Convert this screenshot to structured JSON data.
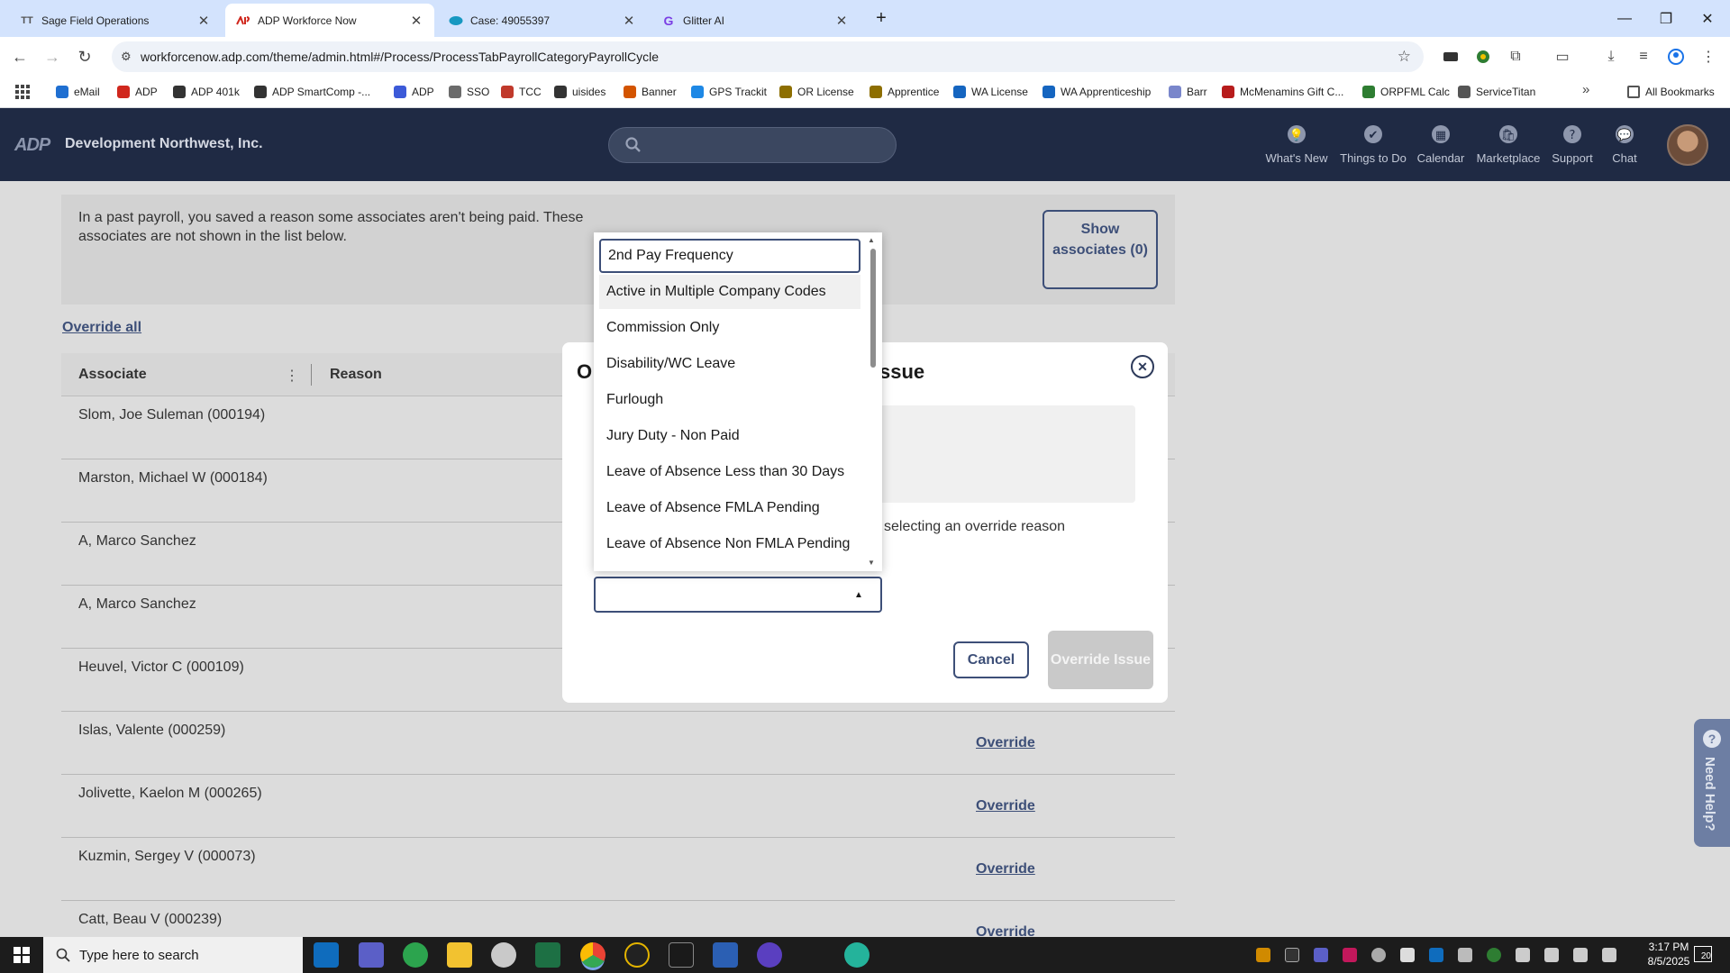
{
  "browser": {
    "tabs": [
      {
        "label": "Sage Field Operations",
        "favicon": "TT",
        "active": false
      },
      {
        "label": "ADP Workforce Now",
        "favicon": "adp-icon",
        "active": true
      },
      {
        "label": "Case: 49055397",
        "favicon": "salesforce-cloud-icon",
        "active": false
      },
      {
        "label": "Glitter AI",
        "favicon": "G",
        "active": false
      }
    ],
    "url": "workforcenow.adp.com/theme/admin.html#/Process/ProcessTabPayrollCategoryPayrollCycle",
    "bookmarks": [
      {
        "label": "eMail",
        "color": "#1f6fd1"
      },
      {
        "label": "ADP",
        "color": "#d0271d"
      },
      {
        "label": "ADP 401k",
        "color": "#333333"
      },
      {
        "label": "ADP SmartComp -...",
        "color": "#333333"
      },
      {
        "label": "ADP",
        "color": "#3c5ad8"
      },
      {
        "label": "SSO",
        "color": "#6b6b6b"
      },
      {
        "label": "TCC",
        "color": "#c0392b"
      },
      {
        "label": "uisides",
        "color": "#333333"
      },
      {
        "label": "Banner",
        "color": "#d35400"
      },
      {
        "label": "GPS Trackit",
        "color": "#1e88e5"
      },
      {
        "label": "OR License",
        "color": "#8d6e00"
      },
      {
        "label": "Apprentice",
        "color": "#8d6e00"
      },
      {
        "label": "WA License",
        "color": "#1565c0"
      },
      {
        "label": "WA Apprenticeship",
        "color": "#1565c0"
      },
      {
        "label": "Barr",
        "color": "#7986cb"
      },
      {
        "label": "McMenamins Gift C...",
        "color": "#b71c1c"
      },
      {
        "label": "ORPFML Calc",
        "color": "#2e7d32"
      },
      {
        "label": "ServiceTitan",
        "color": "#555555"
      }
    ],
    "all_bookmarks": "All Bookmarks"
  },
  "adp": {
    "logo": "ADP",
    "company": "Development Northwest, Inc.",
    "nav": [
      {
        "label": "What's New",
        "icon": "lightbulb-icon"
      },
      {
        "label": "Things to Do",
        "icon": "checkmark-icon"
      },
      {
        "label": "Calendar",
        "icon": "calendar-icon"
      },
      {
        "label": "Marketplace",
        "icon": "bag-icon"
      },
      {
        "label": "Support",
        "icon": "question-icon"
      },
      {
        "label": "Chat",
        "icon": "chat-icon"
      }
    ]
  },
  "page": {
    "past_message": "In a past payroll, you saved a reason some associates aren't being paid. These associates are not shown in the list below.",
    "show_associates": "Show associates (0)",
    "override_all": "Override all",
    "columns": {
      "associate": "Associate",
      "reason": "Reason"
    },
    "rows": [
      {
        "name": "Slom, Joe Suleman (000194)",
        "action": ""
      },
      {
        "name": "Marston, Michael W (000184)",
        "action": ""
      },
      {
        "name": "A, Marco Sanchez",
        "action": ""
      },
      {
        "name": "A, Marco Sanchez",
        "action": ""
      },
      {
        "name": "Heuvel, Victor C (000109)",
        "action": ""
      },
      {
        "name": "Islas, Valente (000259)",
        "action": "Override"
      },
      {
        "name": "Jolivette, Kaelon M (000265)",
        "action": "Override"
      },
      {
        "name": "Kuzmin, Sergey V (000073)",
        "action": "Override"
      },
      {
        "name": "Catt, Beau V (000239)",
        "action": "Override"
      }
    ],
    "need_help": "Need Help?"
  },
  "modal": {
    "title_start": "O",
    "title_end": "ssue",
    "instruction": "selecting an override reason",
    "cancel": "Cancel",
    "override": "Override Issue"
  },
  "dropdown": {
    "options": [
      "2nd Pay Frequency",
      "Active in Multiple Company Codes",
      "Commission Only",
      "Disability/WC Leave",
      "Furlough",
      "Jury Duty - Non Paid",
      "Leave of Absence Less than 30 Days",
      "Leave of Absence FMLA Pending",
      "Leave of Absence Non FMLA Pending"
    ],
    "focused_index": 0,
    "hover_index": 1
  },
  "taskbar": {
    "search_placeholder": "Type here to search",
    "time": "3:17 PM",
    "date": "8/5/2025",
    "notification_count": "20"
  }
}
